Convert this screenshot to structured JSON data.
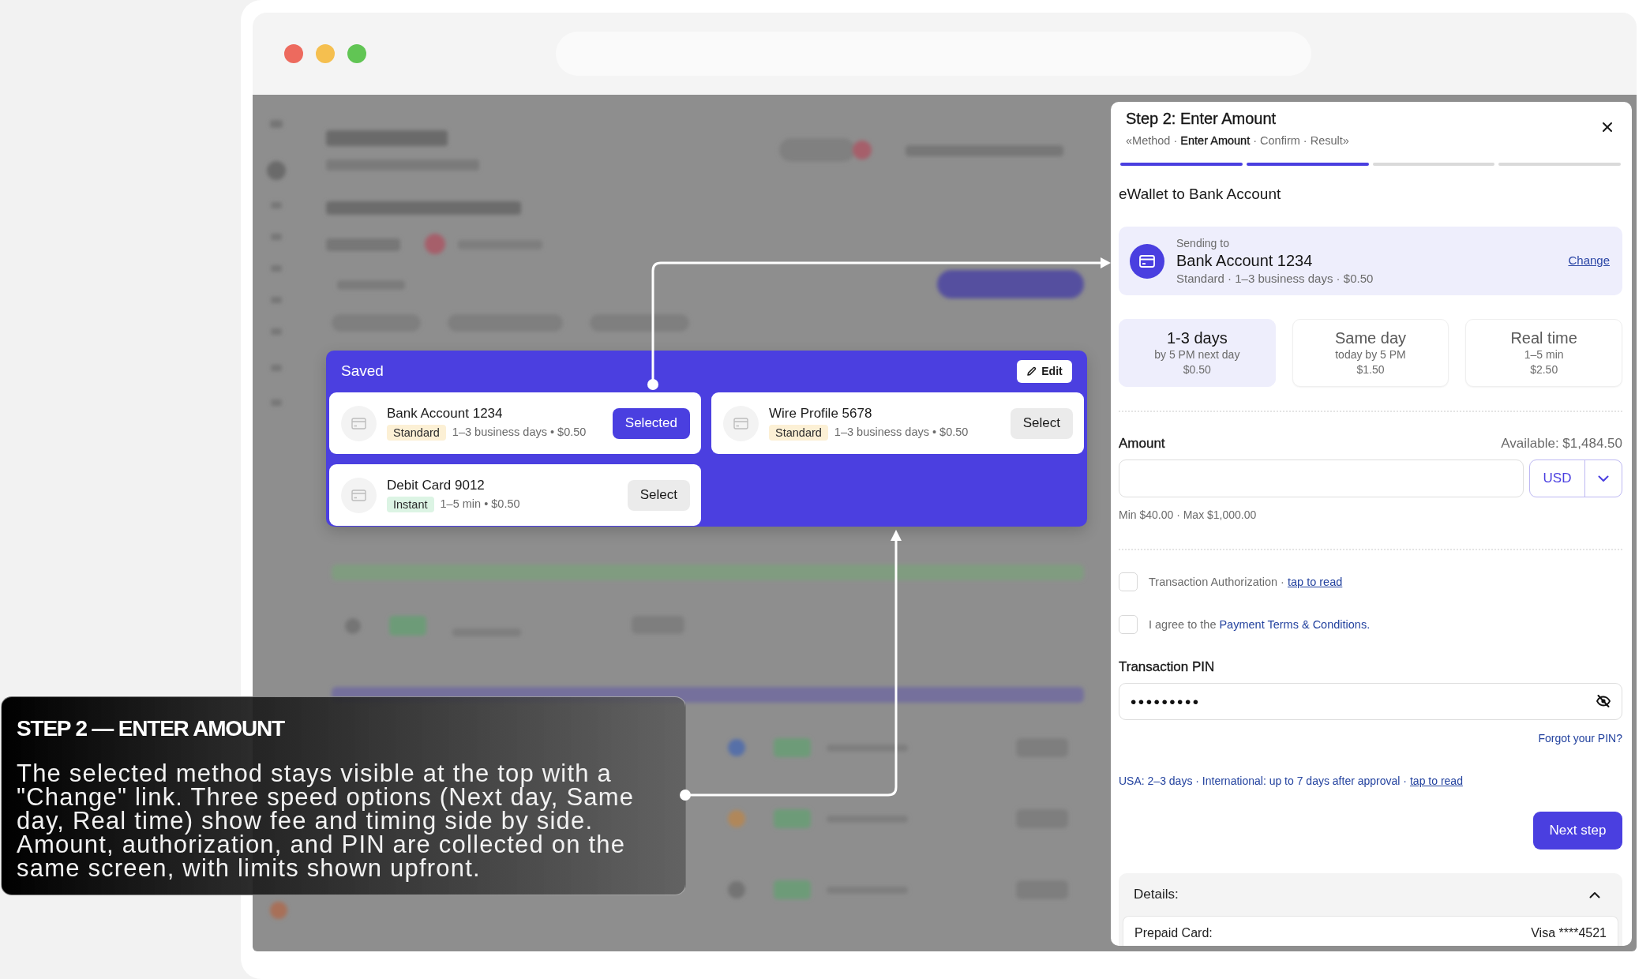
{
  "browser": {
    "traffic_lights": [
      {
        "color": "#ed6a5e"
      },
      {
        "color": "#f5bf4f"
      },
      {
        "color": "#61c554"
      }
    ]
  },
  "saved": {
    "title": "Saved",
    "edit": "Edit",
    "items": [
      {
        "name": "Bank Account 1234",
        "tag": {
          "text": "Standard",
          "color": "#fcf0d5"
        },
        "detail": "1–3 business days • $0.50",
        "button": "Selected",
        "selected": true
      },
      {
        "name": "Wire Profile 5678",
        "tag": {
          "text": "Standard",
          "color": "#fcf0d5"
        },
        "detail": "1–3 business days • $0.50",
        "button": "Select",
        "selected": false
      },
      {
        "name": "Debit Card 9012",
        "tag": {
          "text": "Instant",
          "color": "#dcf4e4"
        },
        "detail": "1–5 min • $0.50",
        "button": "Select",
        "selected": false
      }
    ]
  },
  "panel": {
    "title": "Step 2: Enter Amount",
    "breadcrumb": "«Method · **Enter Amount** · Confirm · Result»",
    "progress": [
      {
        "filled": true
      },
      {
        "filled": true
      },
      {
        "filled": false
      },
      {
        "filled": false
      }
    ],
    "heading": "eWallet to Bank Account",
    "sending_to": {
      "label": "Sending to",
      "name": "Bank Account 1234",
      "detail": "Standard · 1–3 business days · $0.50",
      "link": "Change"
    },
    "speeds": [
      {
        "title": "1-3 days",
        "timing": "by 5 PM next day",
        "fee": "$0.50",
        "selected": true
      },
      {
        "title": "Same day",
        "timing": "today by 5 PM",
        "fee": "$1.50",
        "selected": false
      },
      {
        "title": "Real time",
        "timing": "1–5 min",
        "fee": "$2.50",
        "selected": false
      }
    ],
    "amount": {
      "label": "Amount",
      "available": "Available: $1,484.50",
      "currency": "USD",
      "limits": "Min $40.00 · Max $1,000.00"
    },
    "agreements": [
      {
        "text": "Transaction Authorization ·",
        "link": "tap to read",
        "kind": "underline",
        "checked": false
      },
      {
        "text": "I agree to the",
        "link": "Payment Terms & Conditions.",
        "kind": "plain",
        "checked": false
      }
    ],
    "pin": {
      "label": "Transaction PIN",
      "value": "•••••••••",
      "forgot": "Forgot your PIN?"
    },
    "notice": {
      "text": "USA: 2–3 days · International: up to 7 days after approval ·",
      "link": "tap to read"
    },
    "next_button": "Next step",
    "details": {
      "title": "Details:",
      "expanded": true,
      "rows": [
        {
          "label": "Prepaid Card:",
          "value": "Visa ****4521"
        }
      ]
    }
  },
  "caption": {
    "title": "STEP 2 — ENTER AMOUNT",
    "text": "The selected method stays visible at the top with a \"Change\" link. Three speed options (Next day, Same day, Real time) show fee and timing side by side. Amount, authorization, and PIN are collected on the same screen, with limits shown upfront."
  }
}
